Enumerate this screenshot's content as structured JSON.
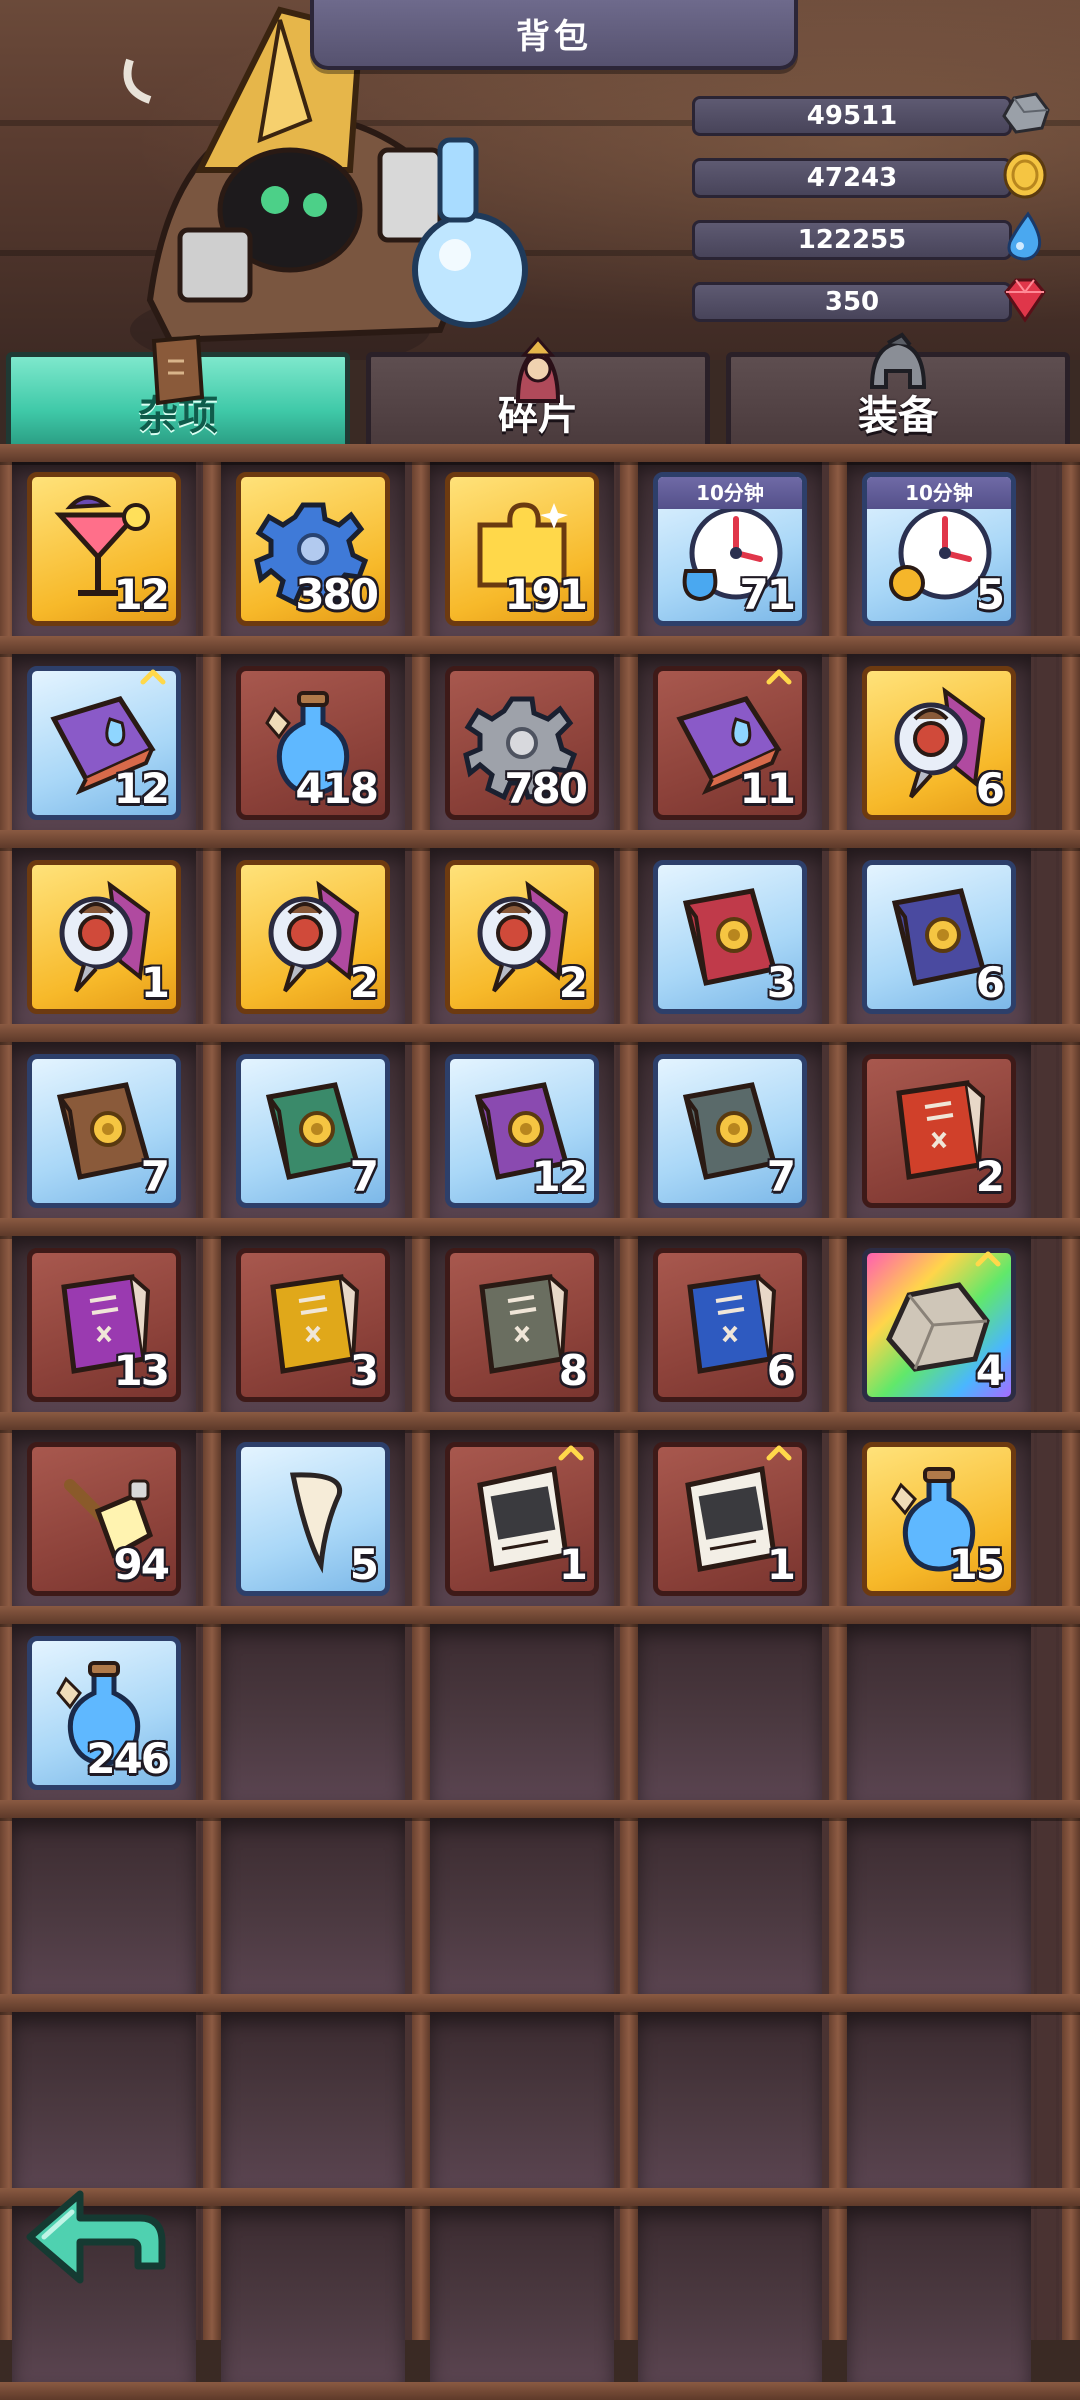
{
  "header": {
    "title": "背包"
  },
  "currencies": [
    {
      "value": "49511",
      "icon": "stone-icon",
      "color": "#9aa0a8"
    },
    {
      "value": "47243",
      "icon": "gold-coin-icon",
      "color": "#f5c542"
    },
    {
      "value": "122255",
      "icon": "water-drop-icon",
      "color": "#4aa8f0"
    },
    {
      "value": "350",
      "icon": "red-gem-icon",
      "color": "#e0364a"
    }
  ],
  "tabs": [
    {
      "label": "杂项",
      "icon": "scroll-icon",
      "active": true
    },
    {
      "label": "碎片",
      "icon": "hero-icon",
      "active": false
    },
    {
      "label": "装备",
      "icon": "helmet-icon",
      "active": false
    }
  ],
  "items": [
    {
      "name": "cocktail",
      "icon": "cocktail-icon",
      "rarity": "gold",
      "qty": "12"
    },
    {
      "name": "gear-blue",
      "icon": "blue-gear-icon",
      "rarity": "gold",
      "qty": "380"
    },
    {
      "name": "puzzle-piece",
      "icon": "puzzle-icon",
      "rarity": "gold",
      "qty": "191"
    },
    {
      "name": "timer-potion",
      "icon": "clock-potion-icon",
      "rarity": "blue",
      "qty": "71",
      "timer": "10分钟"
    },
    {
      "name": "timer-gear",
      "icon": "clock-gear-icon",
      "rarity": "blue",
      "qty": "5",
      "timer": "10分钟"
    },
    {
      "name": "potion-book-blue",
      "icon": "purple-book-icon",
      "rarity": "blue",
      "qty": "12",
      "upgrade": true
    },
    {
      "name": "potion-red",
      "icon": "potion-icon",
      "rarity": "red",
      "qty": "418"
    },
    {
      "name": "gear-grey",
      "icon": "grey-gear-icon",
      "rarity": "red",
      "qty": "780"
    },
    {
      "name": "potion-book-red",
      "icon": "purple-book-icon",
      "rarity": "red",
      "qty": "11",
      "upgrade": true
    },
    {
      "name": "compass-amulet",
      "icon": "amulet-icon",
      "rarity": "gold",
      "qty": "6"
    },
    {
      "name": "amulet-1",
      "icon": "amulet-icon",
      "rarity": "gold",
      "qty": "1"
    },
    {
      "name": "amulet-2",
      "icon": "amulet-icon",
      "rarity": "gold",
      "qty": "2"
    },
    {
      "name": "amulet-3",
      "icon": "amulet-icon",
      "rarity": "gold",
      "qty": "2"
    },
    {
      "name": "tome-red",
      "icon": "red-tome-icon",
      "rarity": "blue",
      "qty": "3"
    },
    {
      "name": "tome-purple",
      "icon": "purple-tome-icon",
      "rarity": "blue",
      "qty": "6"
    },
    {
      "name": "tome-brown",
      "icon": "brown-tome-icon",
      "rarity": "blue",
      "qty": "7"
    },
    {
      "name": "tome-green",
      "icon": "green-tome-icon",
      "rarity": "blue",
      "qty": "7"
    },
    {
      "name": "tome-violet",
      "icon": "violet-tome-icon",
      "rarity": "blue",
      "qty": "12"
    },
    {
      "name": "tome-grey",
      "icon": "grey-tome-icon",
      "rarity": "blue",
      "qty": "7"
    },
    {
      "name": "manual-red",
      "icon": "red-manual-icon",
      "rarity": "red",
      "qty": "2"
    },
    {
      "name": "manual-purple",
      "icon": "purple-manual-icon",
      "rarity": "red",
      "qty": "13"
    },
    {
      "name": "manual-yellow",
      "icon": "yellow-manual-icon",
      "rarity": "red",
      "qty": "3"
    },
    {
      "name": "manual-grey",
      "icon": "grey-manual-icon",
      "rarity": "red",
      "qty": "8"
    },
    {
      "name": "manual-blue",
      "icon": "blue-manual-icon",
      "rarity": "red",
      "qty": "6"
    },
    {
      "name": "ore-rock",
      "icon": "rock-icon",
      "rarity": "rainbow",
      "qty": "4",
      "upgrade": true
    },
    {
      "name": "glue-brush",
      "icon": "glue-icon",
      "rarity": "red",
      "qty": "94"
    },
    {
      "name": "fang",
      "icon": "fang-icon",
      "rarity": "blue",
      "qty": "5"
    },
    {
      "name": "wanted-rifle",
      "icon": "wanted-poster-icon",
      "rarity": "red",
      "qty": "1",
      "upgrade": true
    },
    {
      "name": "wanted-face",
      "icon": "wanted-poster-icon",
      "rarity": "red",
      "qty": "1",
      "upgrade": true
    },
    {
      "name": "potion-gold",
      "icon": "potion-icon",
      "rarity": "gold",
      "qty": "15"
    },
    {
      "name": "potion-blue",
      "icon": "potion-icon",
      "rarity": "blue",
      "qty": "246"
    }
  ],
  "back_button": {
    "icon": "back-arrow-icon"
  }
}
